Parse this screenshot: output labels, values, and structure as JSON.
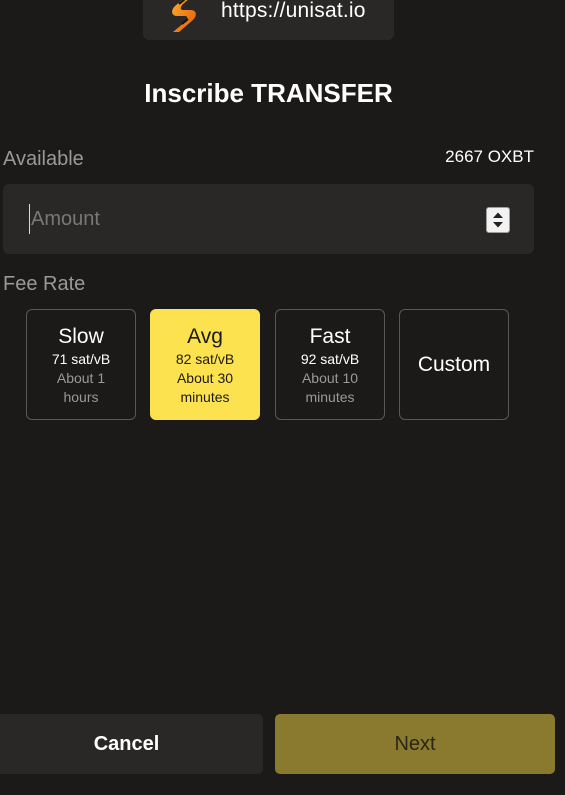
{
  "origin": {
    "url": "https://unisat.io",
    "logo": "unisat-logo-icon"
  },
  "title": "Inscribe TRANSFER",
  "available": {
    "label": "Available",
    "value": "2667 OXBT"
  },
  "amount": {
    "placeholder": "Amount",
    "value": ""
  },
  "fee": {
    "label": "Fee Rate",
    "options": [
      {
        "title": "Slow",
        "rate": "71 sat/vB",
        "time": "About 1 hours",
        "selected": false
      },
      {
        "title": "Avg",
        "rate": "82 sat/vB",
        "time": "About 30 minutes",
        "selected": true
      },
      {
        "title": "Fast",
        "rate": "92 sat/vB",
        "time": "About 10 minutes",
        "selected": false
      },
      {
        "title": "Custom",
        "selected": false
      }
    ]
  },
  "buttons": {
    "cancel": "Cancel",
    "next": "Next"
  },
  "colors": {
    "background": "#1c1a19",
    "panel": "#2a2827",
    "accent": "#fce24f",
    "next_disabled": "#8a7a2f"
  }
}
